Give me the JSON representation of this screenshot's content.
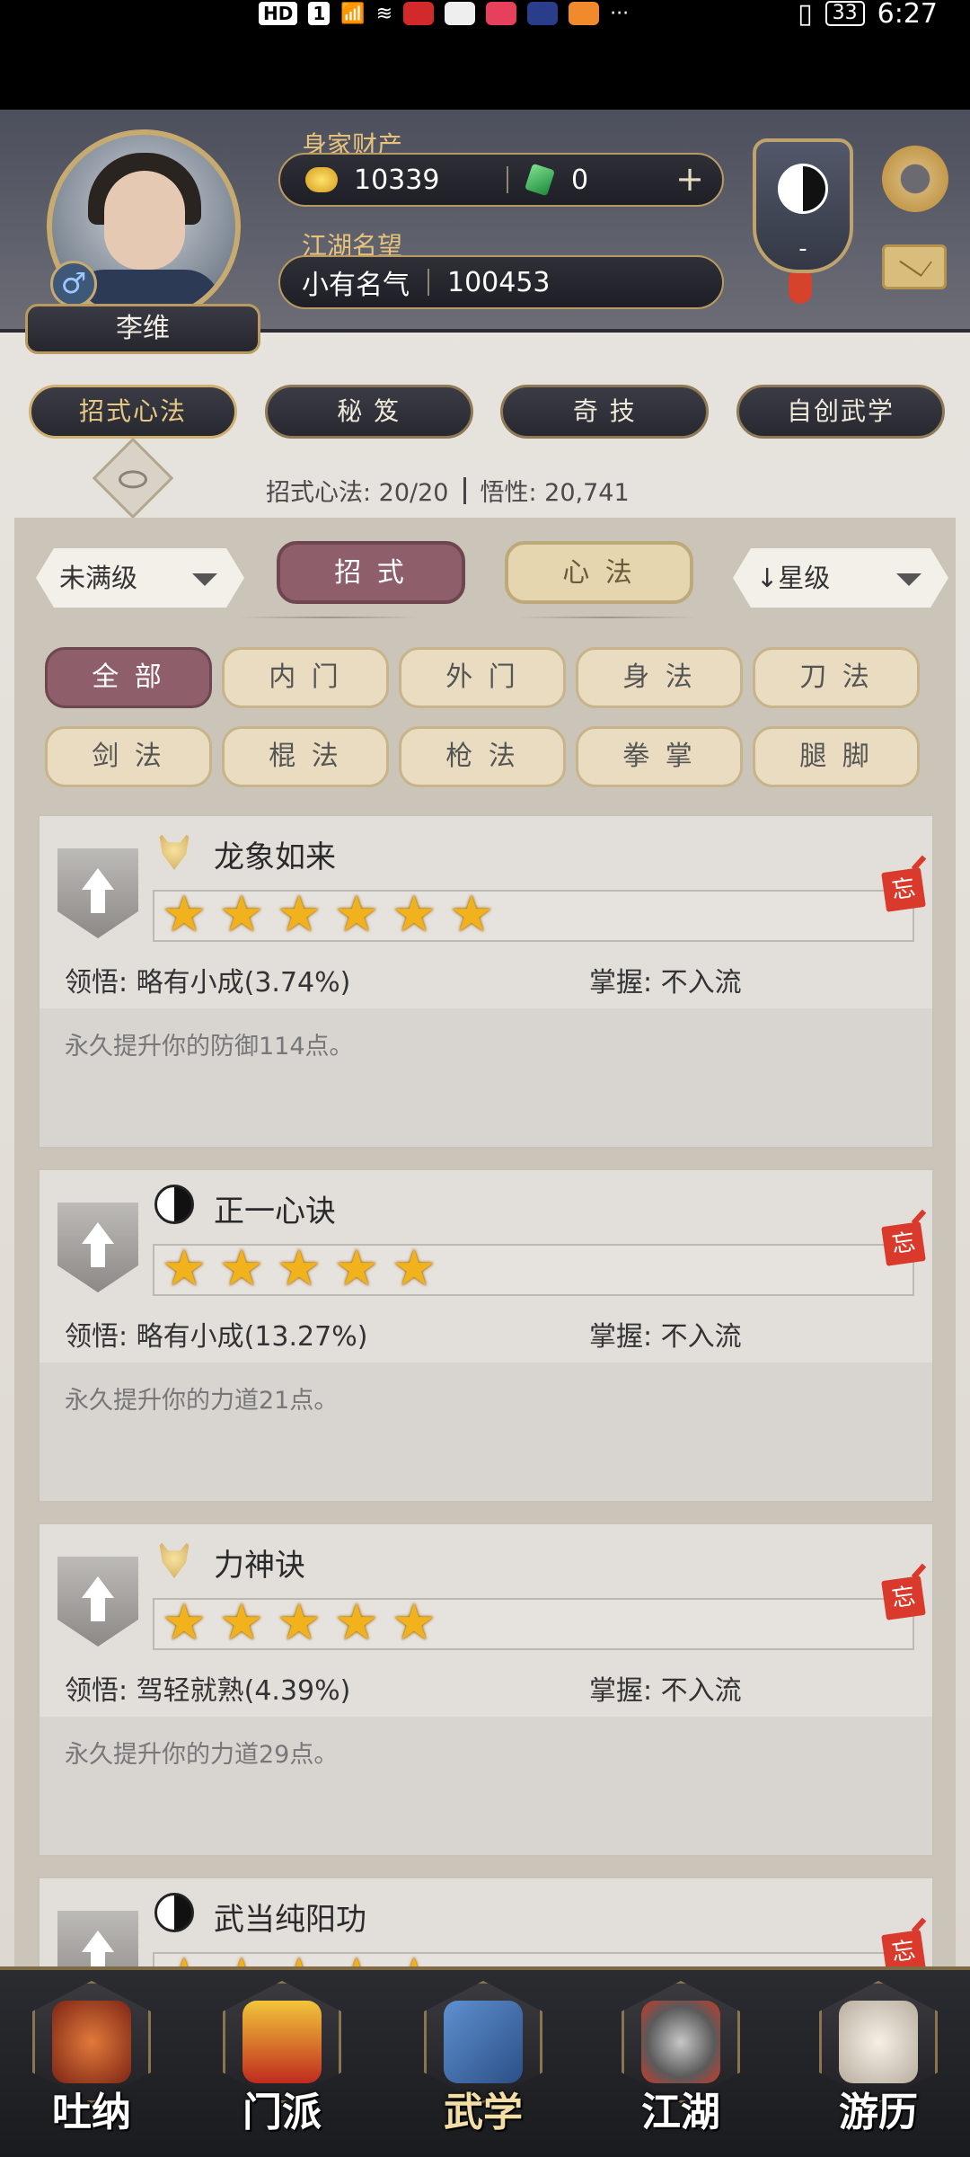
{
  "status_bar": {
    "left_chips": [
      "HD",
      "1",
      "5G"
    ],
    "battery": "33",
    "time": "6:27"
  },
  "header": {
    "wealth_label": "身家财产",
    "gold": "10339",
    "jade": "0",
    "reputation_label": "江湖名望",
    "reputation_title": "小有名气",
    "reputation_value": "100453",
    "player_name": "李维",
    "badge_text": "-"
  },
  "main_tabs": [
    {
      "label": "招式心法",
      "active": true
    },
    {
      "label": "秘 笈",
      "active": false
    },
    {
      "label": "奇 技",
      "active": false
    },
    {
      "label": "自创武学",
      "active": false
    }
  ],
  "summary": {
    "moves": "招式心法: 20/20",
    "insight": "悟性: 20,741"
  },
  "filters": {
    "level": "未满级",
    "seg_move": "招 式",
    "seg_mind": "心 法",
    "sort": "↓星级"
  },
  "categories": [
    "全 部",
    "内 门",
    "外 门",
    "身 法",
    "刀 法",
    "剑 法",
    "棍 法",
    "枪 法",
    "拳 掌",
    "腿 脚"
  ],
  "skills": [
    {
      "name": "龙象如来",
      "icon": "bull-icon",
      "stars": 6,
      "comprehension": "领悟:  略有小成(3.74%)",
      "mastery": "掌握:  不入流",
      "desc": "永久提升你的防御114点。"
    },
    {
      "name": "正一心诀",
      "icon": "yinyang-icon",
      "stars": 5,
      "comprehension": "领悟:  略有小成(13.27%)",
      "mastery": "掌握:  不入流",
      "desc": "永久提升你的力道21点。"
    },
    {
      "name": "力神诀",
      "icon": "bull-icon",
      "stars": 5,
      "comprehension": "领悟:  驾轻就熟(4.39%)",
      "mastery": "掌握:  不入流",
      "desc": "永久提升你的力道29点。"
    },
    {
      "name": "武当纯阳功",
      "icon": "yinyang-icon",
      "stars": 5
    }
  ],
  "forget_label": "忘",
  "bottom_nav": [
    {
      "label": "吐纳",
      "active": false,
      "color": "#b5462c"
    },
    {
      "label": "门派",
      "active": false,
      "color": "#d8a21f"
    },
    {
      "label": "武学",
      "active": true,
      "color": "#3f6fb0"
    },
    {
      "label": "江湖",
      "active": false,
      "color": "#8c8c8c"
    },
    {
      "label": "游历",
      "active": false,
      "color": "#d9d2c7"
    }
  ]
}
